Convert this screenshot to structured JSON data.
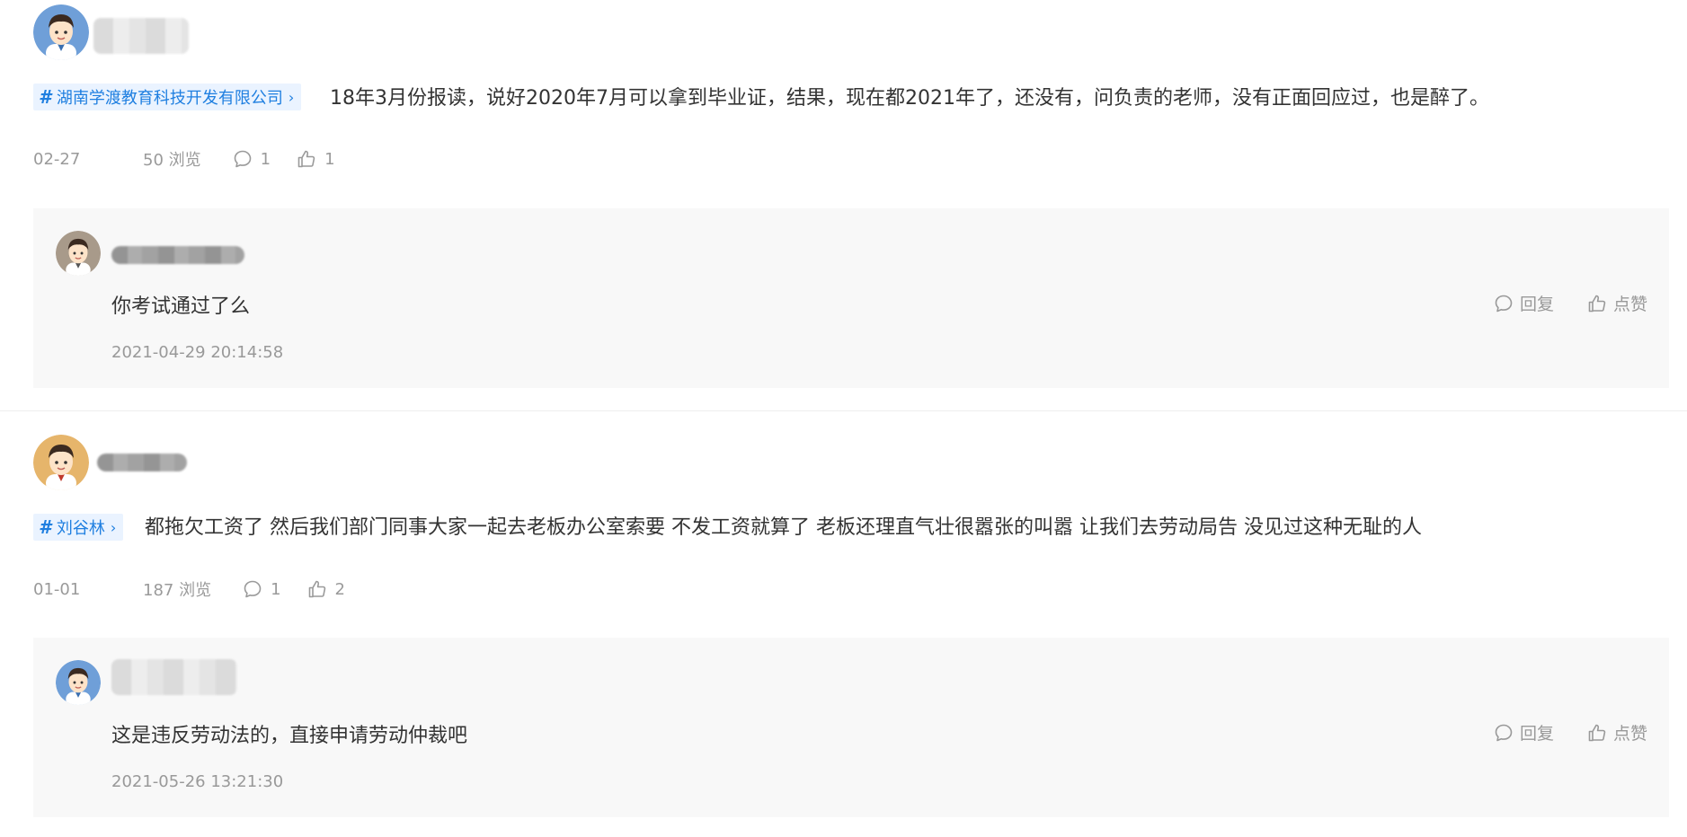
{
  "posts": [
    {
      "tag": "湖南学渡教育科技开发有限公司",
      "text": "18年3月份报读，说好2020年7月可以拿到毕业证，结果，现在都2021年了，还没有，问负责的老师，没有正面回应过，也是醉了。",
      "date": "02-27",
      "views": "50 浏览",
      "comments": "1",
      "likes": "1",
      "reply": {
        "text": "你考试通过了么",
        "time": "2021-04-29 20:14:58",
        "reply_label": "回复",
        "like_label": "点赞"
      }
    },
    {
      "tag": "刘谷林",
      "text": "都拖欠工资了 然后我们部门同事大家一起去老板办公室索要 不发工资就算了 老板还理直气壮很嚣张的叫嚣 让我们去劳动局告 没见过这种无耻的人",
      "date": "01-01",
      "views": "187 浏览",
      "comments": "1",
      "likes": "2",
      "reply": {
        "text": "这是违反劳动法的，直接申请劳动仲裁吧",
        "time": "2021-05-26 13:21:30",
        "reply_label": "回复",
        "like_label": "点赞"
      }
    }
  ],
  "colors": {
    "tag_bg": "#eaf3ff",
    "tag_text": "#1f7fe0",
    "reply_bg": "#f8f8f8",
    "muted": "#999999"
  }
}
